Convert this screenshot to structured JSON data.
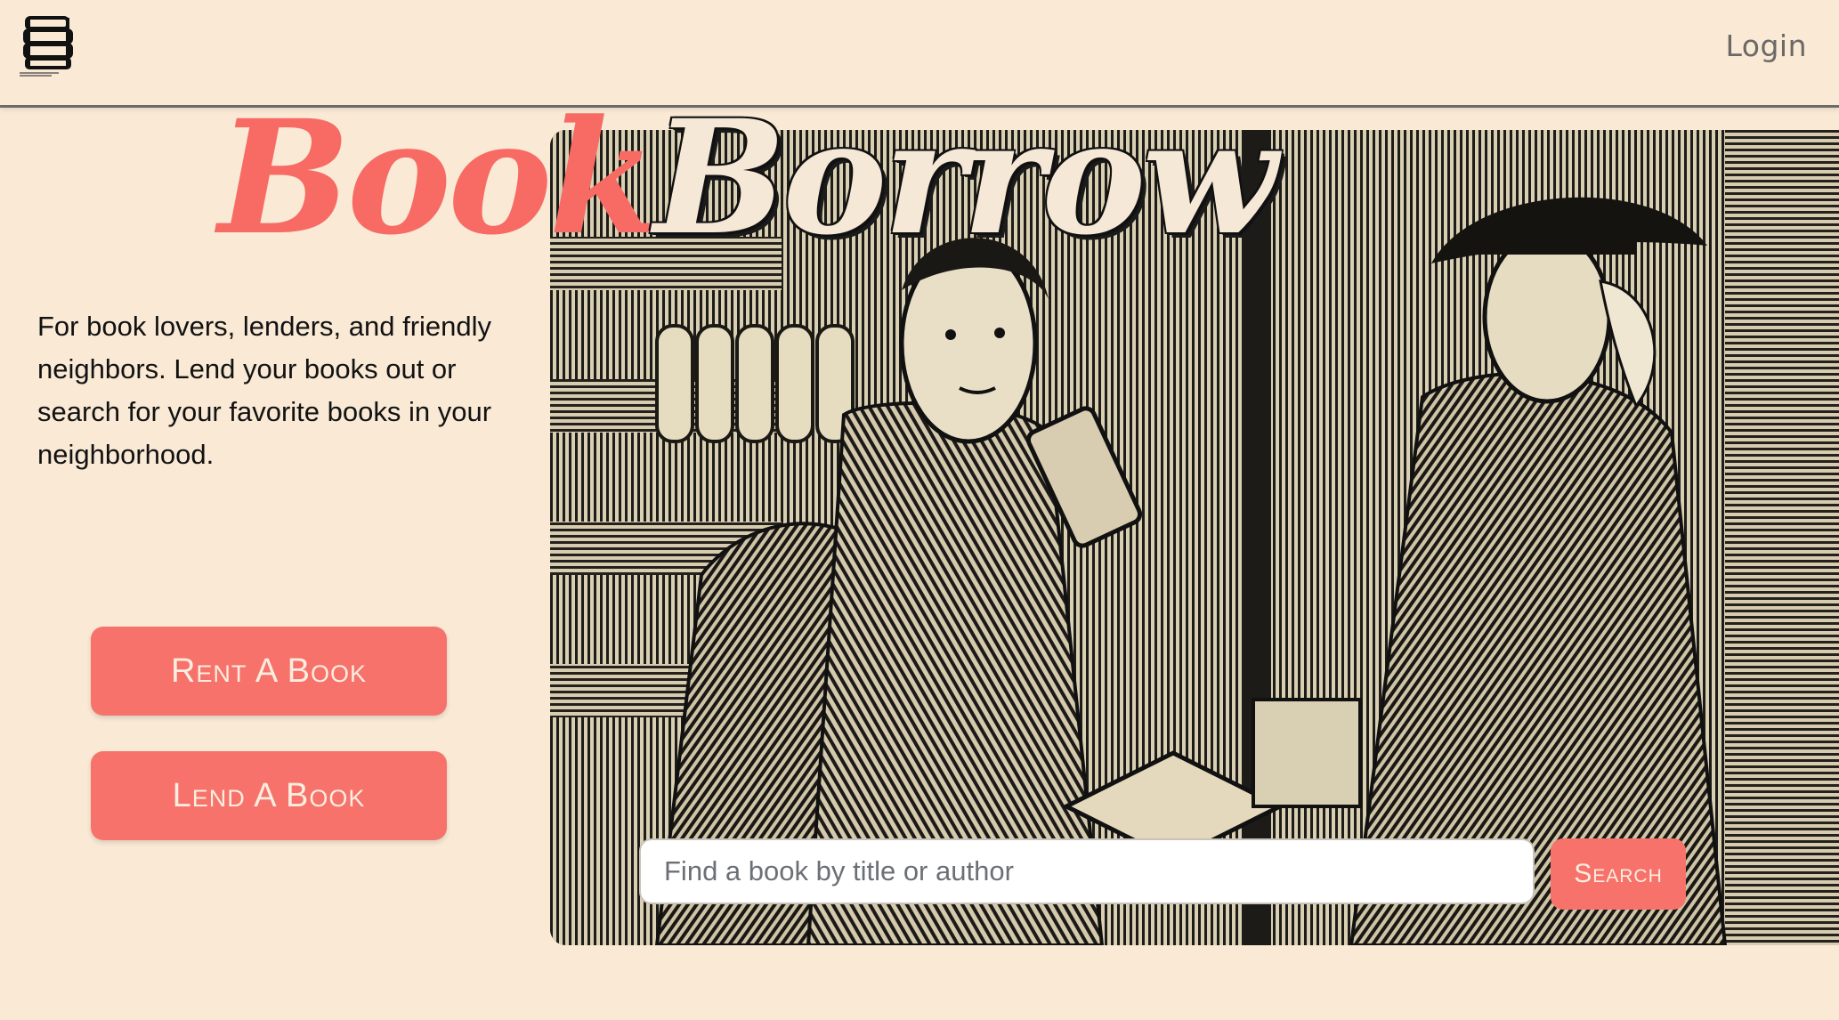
{
  "header": {
    "logo_icon": "bookshelf-logo-icon",
    "login_label": "Login"
  },
  "hero": {
    "title_part1": "Book",
    "title_part2": "Borrow",
    "description": "For book lovers, lenders, and friendly neighbors. Lend your books out or search for your favorite books in your neighborhood.",
    "image_icon": "vintage-bookshop-engraving"
  },
  "actions": {
    "rent_label": "Rent A Book",
    "lend_label": "Lend A Book"
  },
  "search": {
    "placeholder": "Find a book by title or author",
    "value": "",
    "button_label": "Search"
  },
  "colors": {
    "background": "#f9e9d5",
    "accent": "#f7726b",
    "title_book": "#f76b64"
  }
}
